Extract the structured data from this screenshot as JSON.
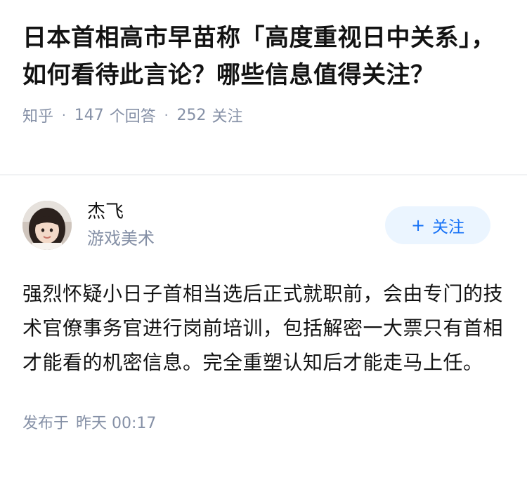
{
  "question": {
    "title": "日本首相高市早苗称「高度重视日中关系」，如何看待此言论？哪些信息值得关注？",
    "source": "知乎",
    "answer_count": "147",
    "answer_label": "个回答",
    "follower_count": "252",
    "follower_label": "关注"
  },
  "answer": {
    "author_name": "杰飞",
    "author_bio": "游戏美术",
    "follow_plus": "+",
    "follow_label": "关注",
    "content": "强烈怀疑小日子首相当选后正式就职前，会由专门的技术官僚事务官进行岗前培训，包括解密一大票只有首相才能看的机密信息。完全重塑认知后才能走马上任。",
    "published_label": "发布于",
    "published_time": "昨天 00:17"
  }
}
